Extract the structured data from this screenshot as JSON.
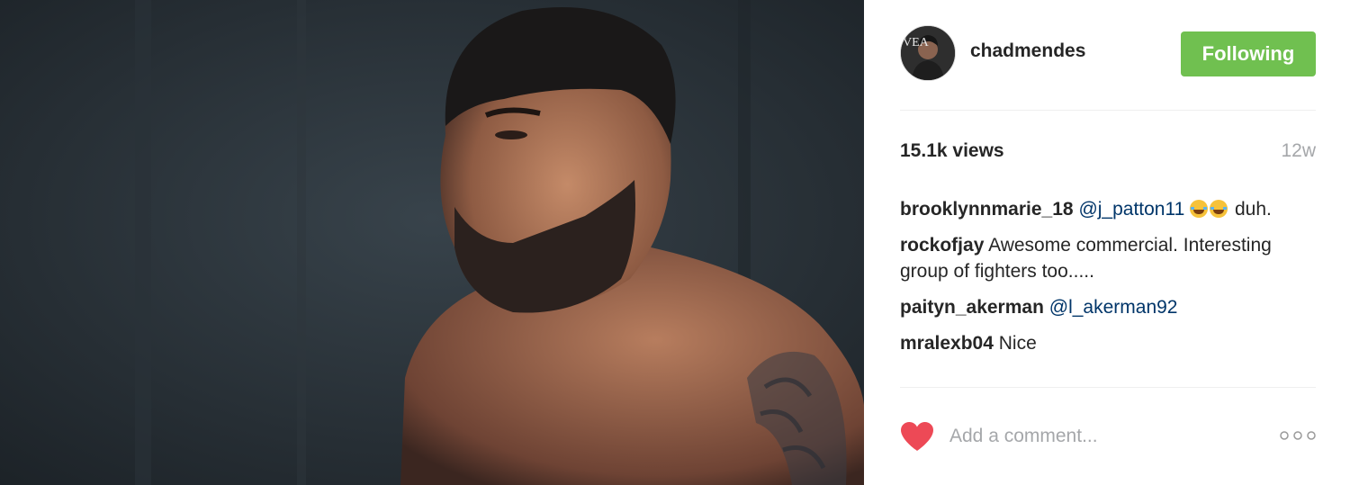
{
  "post": {
    "author": "chadmendes",
    "follow_label": "Following",
    "views": "15.1k views",
    "age": "12w",
    "avatar_text": "VEA"
  },
  "comments": [
    {
      "author": "brooklynnmarie_18",
      "mention": "@j_patton11",
      "text": "duh."
    },
    {
      "author": "rockofjay",
      "text": "Awesome commercial. Interesting group of fighters too....."
    },
    {
      "author": "paityn_akerman",
      "mention": "@l_akerman92"
    },
    {
      "author": "mralexb04",
      "text": "Nice"
    }
  ],
  "footer": {
    "placeholder": "Add a comment..."
  },
  "icons": {
    "like": "heart-icon",
    "more": "more-options-icon",
    "emoji": "face-with-tears-of-joy-emoji"
  },
  "colors": {
    "follow_button": "#70c050",
    "like_heart": "#ed4956",
    "mention": "#003569",
    "muted": "#a5a7aa"
  }
}
